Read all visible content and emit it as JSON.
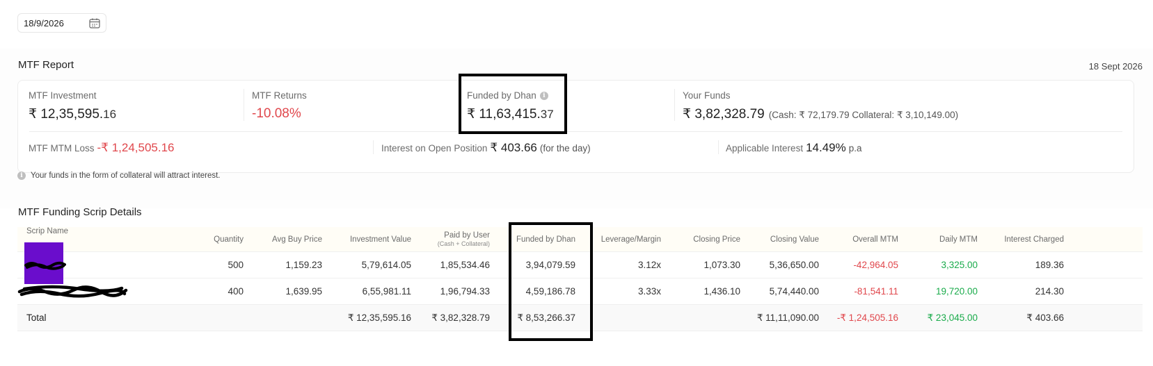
{
  "date_picker": {
    "value": "18/9/2026",
    "icon": "calendar-icon"
  },
  "report": {
    "title": "MTF Report",
    "date": "18 Sept 2026",
    "mtf_investment": {
      "label": "MTF Investment",
      "value": "₹ 12,35,595.",
      "decimals": "16"
    },
    "mtf_returns": {
      "label": "MTF Returns",
      "value": "-10.08%"
    },
    "funded_by_dhan": {
      "label": "Funded by Dhan",
      "value": "₹ 11,63,415.",
      "decimals": "37",
      "icon": "info-icon"
    },
    "your_funds": {
      "label": "Your Funds",
      "value": "₹ 3,82,328.79",
      "breakdown": "(Cash: ₹ 72,179.79 Collateral: ₹ 3,10,149.00)"
    },
    "mtm_loss": {
      "label": "MTF MTM Loss",
      "value": "-₹ 1,24,505.16"
    },
    "interest_open": {
      "label": "Interest on Open Position",
      "value": "₹ 403.66",
      "note": "(for the day)"
    },
    "applicable_interest": {
      "label": "Applicable Interest",
      "value": "14.49%",
      "unit": "p.a"
    }
  },
  "notice": {
    "text": "Your funds in the form of collateral will attract interest.",
    "icon": "info-icon"
  },
  "scrip_details": {
    "title": "MTF Funding Scrip Details",
    "columns": [
      {
        "label": "Scrip Name",
        "sub": ""
      },
      {
        "label": "Quantity",
        "sub": ""
      },
      {
        "label": "Avg Buy Price",
        "sub": ""
      },
      {
        "label": "Investment Value",
        "sub": ""
      },
      {
        "label": "Paid by User",
        "sub": "(Cash + Collateral)"
      },
      {
        "label": "Funded by Dhan",
        "sub": ""
      },
      {
        "label": "Leverage/Margin",
        "sub": ""
      },
      {
        "label": "Closing Price",
        "sub": ""
      },
      {
        "label": "Closing Value",
        "sub": ""
      },
      {
        "label": "Overall MTM",
        "sub": ""
      },
      {
        "label": "Daily MTM",
        "sub": ""
      },
      {
        "label": "Interest Charged",
        "sub": ""
      }
    ],
    "rows": [
      {
        "quantity": "500",
        "avg_buy": "1,159.23",
        "investment": "5,79,614.05",
        "paid_by_user": "1,85,534.46",
        "funded": "3,94,079.59",
        "leverage": "3.12x",
        "closing_price": "1,073.30",
        "closing_value": "5,36,650.00",
        "overall_mtm": "-42,964.05",
        "daily_mtm": "3,325.00",
        "interest": "189.36"
      },
      {
        "quantity": "400",
        "avg_buy": "1,639.95",
        "investment": "6,55,981.11",
        "paid_by_user": "1,96,794.33",
        "funded": "4,59,186.78",
        "leverage": "3.33x",
        "closing_price": "1,436.10",
        "closing_value": "5,74,440.00",
        "overall_mtm": "-81,541.11",
        "daily_mtm": "19,720.00",
        "interest": "214.30"
      }
    ],
    "total": {
      "label": "Total",
      "investment": "₹ 12,35,595.16",
      "paid_by_user": "₹ 3,82,328.79",
      "funded": "₹ 8,53,266.37",
      "closing_value": "₹ 11,11,090.00",
      "overall_mtm": "-₹ 1,24,505.16",
      "daily_mtm": "₹ 23,045.00",
      "interest": "₹ 403.66"
    }
  },
  "colors": {
    "negative": "#e0474c",
    "positive": "#1aab4b",
    "redaction": "#6a0dcc"
  }
}
